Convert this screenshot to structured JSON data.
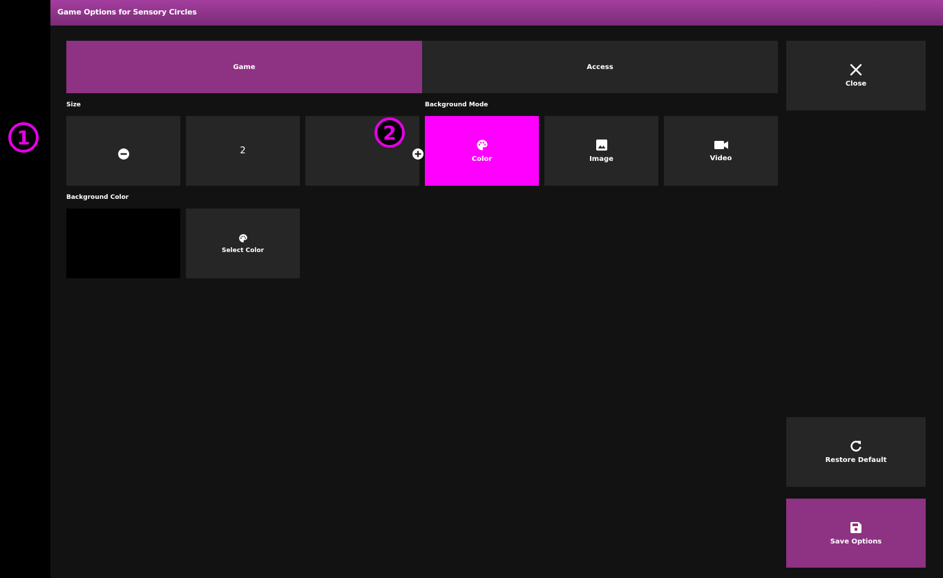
{
  "window": {
    "title": "Game Options for Sensory Circles"
  },
  "tabs": [
    {
      "label": "Game",
      "active": true
    },
    {
      "label": "Access",
      "active": false
    }
  ],
  "close": {
    "label": "Close",
    "icon": "close-icon"
  },
  "size": {
    "label": "Size",
    "value": "2",
    "decrease_icon": "minus-circle-icon",
    "increase_icon": "plus-circle-icon"
  },
  "background_mode": {
    "label": "Background Mode",
    "options": [
      {
        "label": "Color",
        "icon": "palette-icon",
        "selected": true
      },
      {
        "label": "Image",
        "icon": "image-icon",
        "selected": false
      },
      {
        "label": "Video",
        "icon": "video-icon",
        "selected": false
      }
    ]
  },
  "background_color": {
    "label": "Background Color",
    "swatch": "#000000",
    "select_label": "Select Color"
  },
  "restore": {
    "label": "Restore Default",
    "icon": "refresh-icon"
  },
  "save": {
    "label": "Save Options",
    "icon": "save-icon"
  },
  "annotations": [
    "1",
    "2"
  ],
  "colors": {
    "accent": "#8e3283",
    "selected": "#ff00ff",
    "tile": "#262626",
    "panel": "#121212",
    "badge": "#e600e6"
  }
}
